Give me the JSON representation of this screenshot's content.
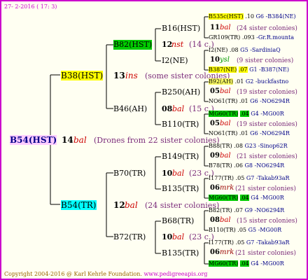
{
  "header": {
    "date": "27-  2-2016 ( 17: 3)",
    "color": "#cc00cc"
  },
  "root": {
    "name": "B54(HST)",
    "num": "14",
    "type": "bal",
    "note": "(Drones from 22 sister colonies)"
  },
  "gen1": {
    "upper": {
      "name": "B38(HST)",
      "num": "13",
      "type": "ins",
      "note": "(some sister colonies)"
    },
    "lower": {
      "name": "B54(TR)",
      "num": "12",
      "type": "bal",
      "note": "(24 sister colonies)"
    }
  },
  "gen2": {
    "b82": {
      "name": "B82(HST)",
      "num": "12",
      "type": "nst",
      "note": "(14 c.)"
    },
    "b46": {
      "name": "B46(AH)",
      "num": "08",
      "type": "bal",
      "note": "(15 c.)"
    },
    "b70": {
      "name": "B70(TR)",
      "num": "10",
      "type": "bal",
      "note": "(23 c.)"
    },
    "b72": {
      "name": "B72(TR)",
      "num": "10",
      "type": "bal",
      "note": "(23 c.)"
    }
  },
  "gen3": {
    "b16": {
      "name": "B16(HST)",
      "num": "11",
      "type": "bal",
      "note": "(24 sister colonies)"
    },
    "i2": {
      "name": "I2(NE)",
      "num": "10",
      "type": "ysl",
      "note": "(9 sister colonies)"
    },
    "b250": {
      "name": "B250(AH)",
      "num": "05",
      "type": "bal",
      "note": "(19 sister colonies)"
    },
    "b110": {
      "name": "B110(TR)",
      "num": "05",
      "type": "bal",
      "note": "(19 sister colonies)"
    },
    "b149": {
      "name": "B149(TR)",
      "num": "09",
      "type": "bal",
      "note": "(21 sister colonies)"
    },
    "b135a": {
      "name": "B135(TR)",
      "num": "06",
      "type": "mrk",
      "note": "(21 sister colonies)"
    },
    "b68": {
      "name": "B68(TR)",
      "num": "08",
      "type": "bal",
      "note": "(15 sister colonies)"
    },
    "b135b": {
      "name": "B135(TR)",
      "num": "06",
      "type": "mrk",
      "note": "(21 sister colonies)"
    }
  },
  "gen4": {
    "r1": {
      "name": "B535c(HST)",
      "yr": ".10",
      "code": "G6 -B384(NE)"
    },
    "r2": {
      "name": "GR109(TR)",
      "yr": ".093",
      "code": "-Gr.R.mounta"
    },
    "r3": {
      "name": "I2(NE)",
      "yr": ".08",
      "code": "G5 -SardiniaQ"
    },
    "r4": {
      "name": "B387(NE)",
      "yr": ".07",
      "code": "G1 -B387(NE)"
    },
    "r5": {
      "name": "B92(AH)",
      "yr": ".01",
      "code": "G2 -buckfastno"
    },
    "r6": {
      "name": "NO61(TR)",
      "yr": ".01",
      "code": "G6 -NO6294R"
    },
    "r7": {
      "name": "MG60(TR)",
      "yr": ".04",
      "code": "G4 -MG00R"
    },
    "r8": {
      "name": "NO61(TR)",
      "yr": ".01",
      "code": "G6 -NO6294R"
    },
    "r9": {
      "name": "B88(TR)",
      "yr": ".08",
      "code": "G23 -Sinop62R"
    },
    "r10": {
      "name": "B78(TR)",
      "yr": ".06",
      "code": "G8 -NO6294R"
    },
    "r11": {
      "name": "I177(TR)",
      "yr": ".05",
      "code": "G7 -Takab93aR"
    },
    "r12": {
      "name": "MG60(TR)",
      "yr": ".04",
      "code": "G4 -MG00R"
    },
    "r13": {
      "name": "B82(TR)",
      "yr": ".07",
      "code": "G9 -NO6294R"
    },
    "r14": {
      "name": "B110(TR)",
      "yr": ".05",
      "code": "G5 -MG00R"
    },
    "r15": {
      "name": "I177(TR)",
      "yr": ".05",
      "code": "G7 -Takab93aR"
    },
    "r16": {
      "name": "MG60(TR)",
      "yr": ".04",
      "code": "G4 -MG00R"
    }
  },
  "footer": {
    "copyright": "Copyright 2004-2016 @ Karl Kehrle Foundation.",
    "url": "www.pedigreeapis.org"
  }
}
